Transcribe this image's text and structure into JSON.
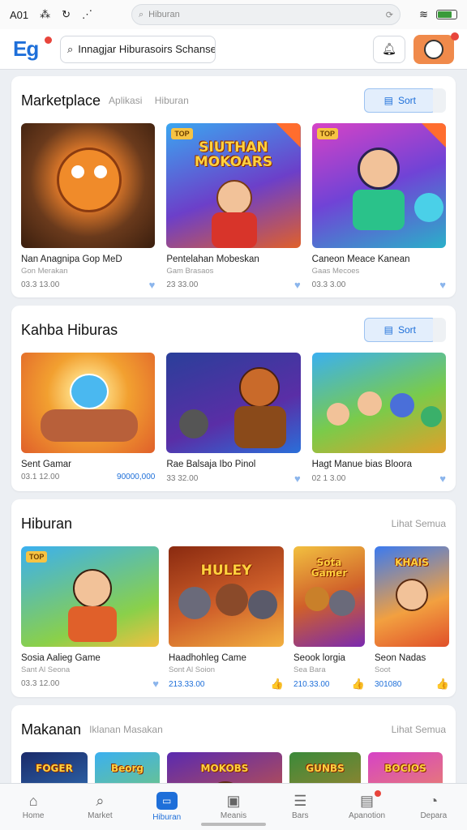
{
  "status": {
    "carrier": "A01",
    "url": "Hiburan",
    "wifi_icon": "wifi-icon",
    "battery_level": 0.7
  },
  "header": {
    "logo": "Eg",
    "search_text": "Innagjar Hiburasoirs Schanseitloada"
  },
  "sections": [
    {
      "title": "Marketplace",
      "sub": [
        "Aplikasi",
        "Hiburan"
      ],
      "button": "Sort",
      "cards": [
        {
          "title": "Nan Anagnipa Gop MeD",
          "sub": "Gon Merakan",
          "price": "03.3 13.00",
          "fav": "♥"
        },
        {
          "title": "Pentelahan Mobeskan",
          "sub": "Gam Brasaos",
          "price": "23 33.00",
          "fav": "♥",
          "art": "SIUTHAN MOKOARS",
          "tag": "TOP"
        },
        {
          "title": "Caneon Meace Kanean",
          "sub": "Gaas Mecoes",
          "price": "03.3 3.00",
          "fav": "♥",
          "tag": "TOP"
        }
      ]
    },
    {
      "title": "Kahba Hiburas",
      "button": "Sort",
      "cards": [
        {
          "title": "Sent Gamar",
          "sub": "",
          "price": "03.1 12.00",
          "accent": "90000,000",
          "fav": ""
        },
        {
          "title": "Rae Balsaja Ibo Pinol",
          "sub": "",
          "price": "33 32.00",
          "fav": "♥"
        },
        {
          "title": "Hagt Manue bias Bloora",
          "sub": "",
          "price": "02 1 3.00",
          "fav": "♥"
        }
      ]
    },
    {
      "title": "Hiburan",
      "more": "Lihat Semua",
      "cards": [
        {
          "title": "Sosia Aalieg Game",
          "sub": "Sant Al Seona",
          "price": "03.3 12.00",
          "fav": "♥",
          "tag": "TOP"
        },
        {
          "title": "Haadhohleg Came",
          "sub": "Sont Al Soion",
          "price": "213.33.00",
          "fav": "👍",
          "art": "HULEY"
        },
        {
          "title": "Seook lorgia",
          "sub": "Sea Bara",
          "price": "210.33.00",
          "fav": "👍",
          "art": "Sota Gamer"
        },
        {
          "title": "Seon Nadas",
          "sub": "Soot",
          "price": "301080",
          "fav": "👍",
          "art": "KHAIS"
        }
      ]
    },
    {
      "title": "Makanan",
      "sub": [
        "Iklanan Masakan"
      ],
      "more": "Lihat Semua",
      "cards": [
        {
          "art": "FOGER"
        },
        {
          "art": "Beorg"
        },
        {
          "art": "MOKOBS"
        },
        {
          "art": "GUNBS"
        },
        {
          "art": "BOCIOS"
        }
      ]
    }
  ],
  "nav": [
    {
      "label": "Home",
      "icon": "home-icon"
    },
    {
      "label": "Market",
      "icon": "search-icon"
    },
    {
      "label": "Hiburan",
      "icon": "chat-icon"
    },
    {
      "label": "Meanis",
      "icon": "box-icon"
    },
    {
      "label": "Bars",
      "icon": "menu-icon"
    },
    {
      "label": "Apanotion",
      "icon": "notification-icon"
    },
    {
      "label": "Depara",
      "icon": "profile-icon"
    }
  ],
  "colors": {
    "accent": "#1e6fd9",
    "badge": "#e8453c"
  }
}
